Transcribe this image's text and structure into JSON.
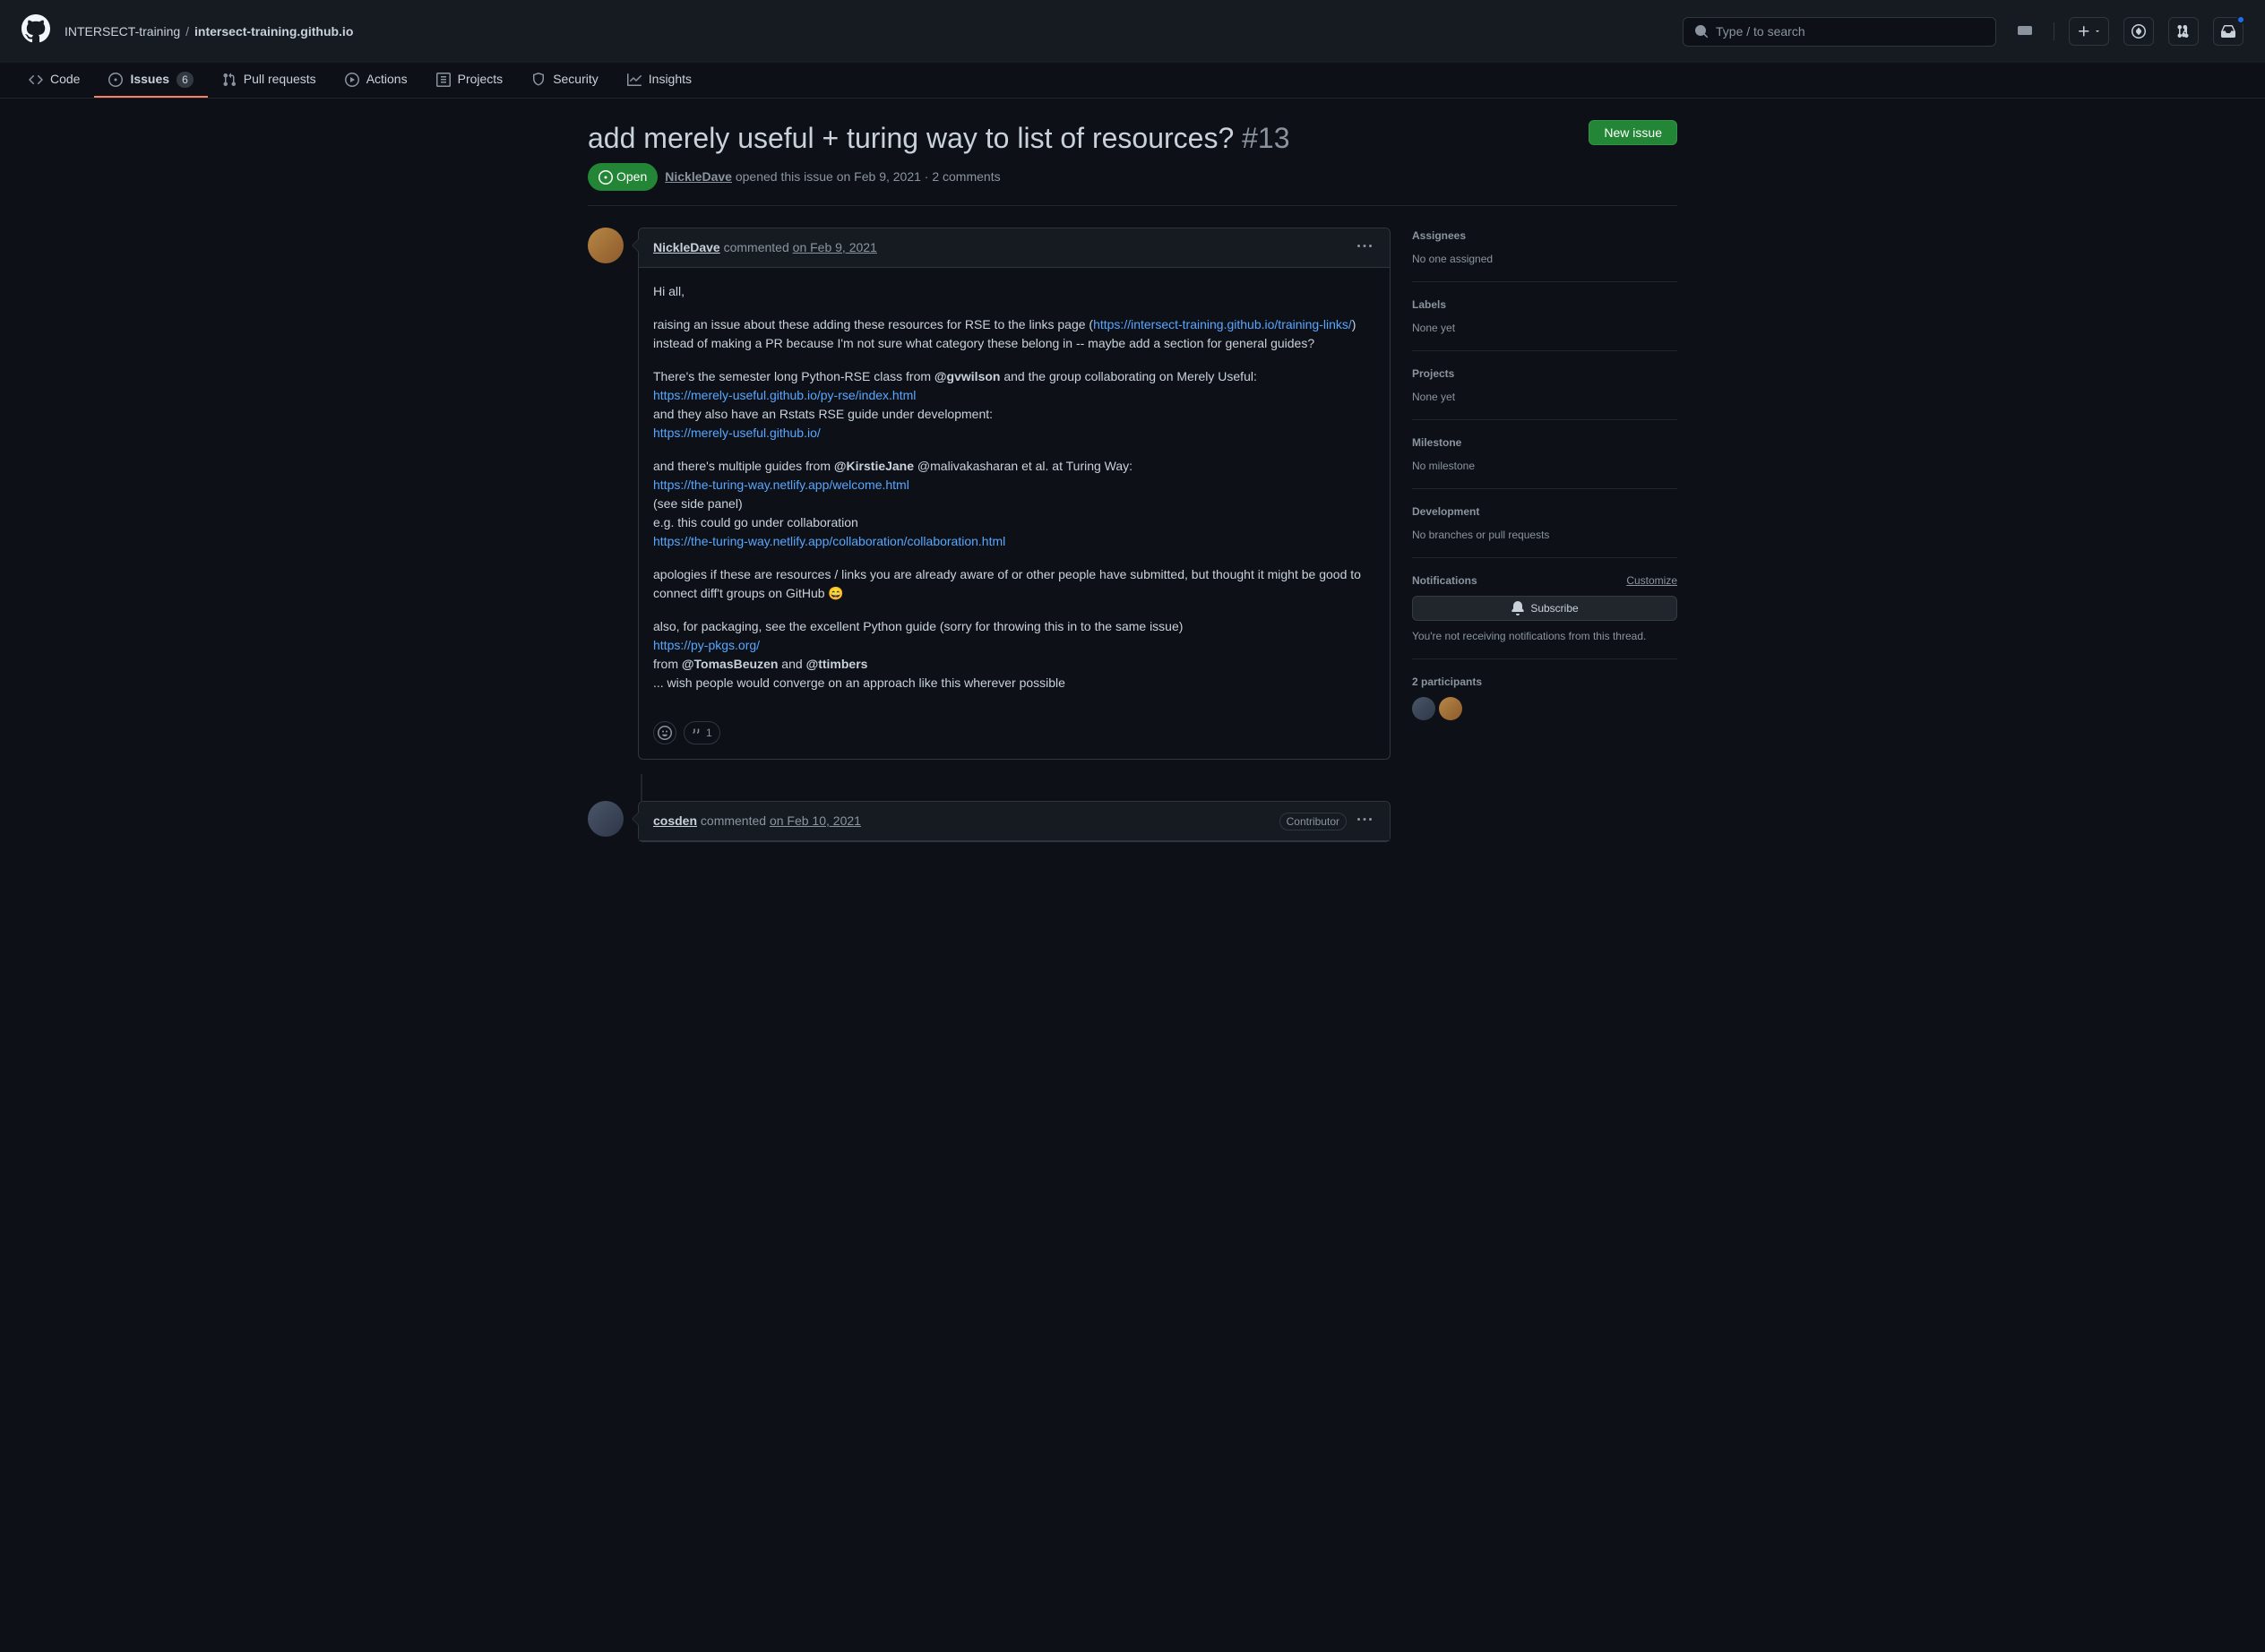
{
  "header": {
    "org": "INTERSECT-training",
    "repo": "intersect-training.github.io",
    "search_placeholder": "Type / to search"
  },
  "nav": {
    "code": "Code",
    "issues": "Issues",
    "issues_count": "6",
    "pulls": "Pull requests",
    "actions": "Actions",
    "projects": "Projects",
    "security": "Security",
    "insights": "Insights"
  },
  "issue": {
    "title": "add merely useful + turing way to list of resources?",
    "number": "#13",
    "new_issue_label": "New issue",
    "status": "Open",
    "author": "NickleDave",
    "opened_text": "opened this issue",
    "opened_date": "on Feb 9, 2021",
    "comment_suffix": "· 2 comments"
  },
  "comments": [
    {
      "author": "NickleDave",
      "commented": "commented",
      "date": "on Feb 9, 2021",
      "body": {
        "greeting": "Hi all,",
        "raising_prefix": "raising an issue about these adding these resources for RSE to the links page (",
        "link_training": "https://intersect-training.github.io/training-links/",
        "instead_suffix": ") instead of making a PR because I'm not sure what category these belong in -- maybe add a section for general guides?",
        "semester_prefix": "There's the semester long Python-RSE class from ",
        "gvwilson": "@gvwilson",
        "group_collab": " and the group collaborating on Merely Useful:",
        "link_pyrse": "https://merely-useful.github.io/py-rse/index.html",
        "and_rstats": "and they also have an Rstats RSE guide under development:",
        "link_merely": "https://merely-useful.github.io/",
        "multiple_prefix": "and there's multiple guides from ",
        "kirstie": "@KirstieJane",
        "malivak": " @malivakasharan et al. at Turing Way:",
        "link_turing1": "https://the-turing-way.netlify.app/welcome.html",
        "see_panel": "(see side panel)",
        "eg_collab": "e.g. this could go under collaboration",
        "link_turing2": "https://the-turing-way.netlify.app/collaboration/collaboration.html",
        "apologies": "apologies if these are resources / links you are already aware of or other people have submitted, but thought it might be good to connect diff't groups on GitHub 😄",
        "also_pkg": "also, for packaging, see the excellent Python guide (sorry for throwing this in to the same issue)",
        "link_pypkgs": "https://py-pkgs.org/",
        "from_prefix": "from ",
        "tomas": "@TomasBeuzen",
        "and_word": " and ",
        "ttimbers": "@ttimbers",
        "wish": "... wish people would converge on an approach like this wherever possible"
      },
      "reaction_count": "1"
    },
    {
      "author": "cosden",
      "commented": "commented",
      "date": "on Feb 10, 2021",
      "contributor_label": "Contributor"
    }
  ],
  "sidebar": {
    "assignees_label": "Assignees",
    "assignees_value": "No one assigned",
    "labels_label": "Labels",
    "labels_value": "None yet",
    "projects_label": "Projects",
    "projects_value": "None yet",
    "milestone_label": "Milestone",
    "milestone_value": "No milestone",
    "development_label": "Development",
    "development_value": "No branches or pull requests",
    "notifications_label": "Notifications",
    "customize_label": "Customize",
    "subscribe_label": "Subscribe",
    "notif_desc": "You're not receiving notifications from this thread.",
    "participants_label": "2 participants"
  }
}
